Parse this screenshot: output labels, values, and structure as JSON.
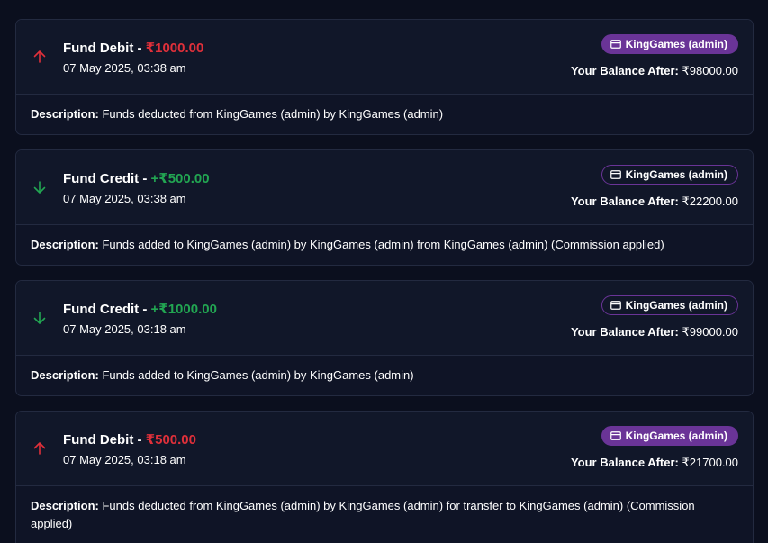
{
  "transactions": [
    {
      "type": "Fund Debit",
      "direction": "debit",
      "amount": "₹1000.00",
      "datetime": "07 May 2025, 03:38 am",
      "badge": "KingGames (admin)",
      "badge_style": "filled",
      "balance_label": "Your Balance After:",
      "balance_value": "₹98000.00",
      "description_label": "Description:",
      "description": "Funds deducted from KingGames (admin) by KingGames (admin)"
    },
    {
      "type": "Fund Credit",
      "direction": "credit",
      "amount": "+₹500.00",
      "datetime": "07 May 2025, 03:38 am",
      "badge": "KingGames (admin)",
      "badge_style": "outline",
      "balance_label": "Your Balance After:",
      "balance_value": "₹22200.00",
      "description_label": "Description:",
      "description": "Funds added to KingGames (admin) by KingGames (admin) from KingGames (admin) (Commission applied)"
    },
    {
      "type": "Fund Credit",
      "direction": "credit",
      "amount": "+₹1000.00",
      "datetime": "07 May 2025, 03:18 am",
      "badge": "KingGames (admin)",
      "badge_style": "outline",
      "balance_label": "Your Balance After:",
      "balance_value": "₹99000.00",
      "description_label": "Description:",
      "description": "Funds added to KingGames (admin) by KingGames (admin)"
    },
    {
      "type": "Fund Debit",
      "direction": "debit",
      "amount": "₹500.00",
      "datetime": "07 May 2025, 03:18 am",
      "badge": "KingGames (admin)",
      "badge_style": "filled",
      "balance_label": "Your Balance After:",
      "balance_value": "₹21700.00",
      "description_label": "Description:",
      "description": "Funds deducted from KingGames (admin) by KingGames (admin) for transfer to KingGames (admin) (Commission applied)"
    }
  ],
  "colors": {
    "debit": "#e0303a",
    "credit": "#22a652",
    "badge": "#6a3497",
    "background": "#0b0f1e"
  },
  "icons": {
    "debit": "arrow-up-icon",
    "credit": "arrow-down-icon",
    "badge": "credit-card-icon"
  }
}
